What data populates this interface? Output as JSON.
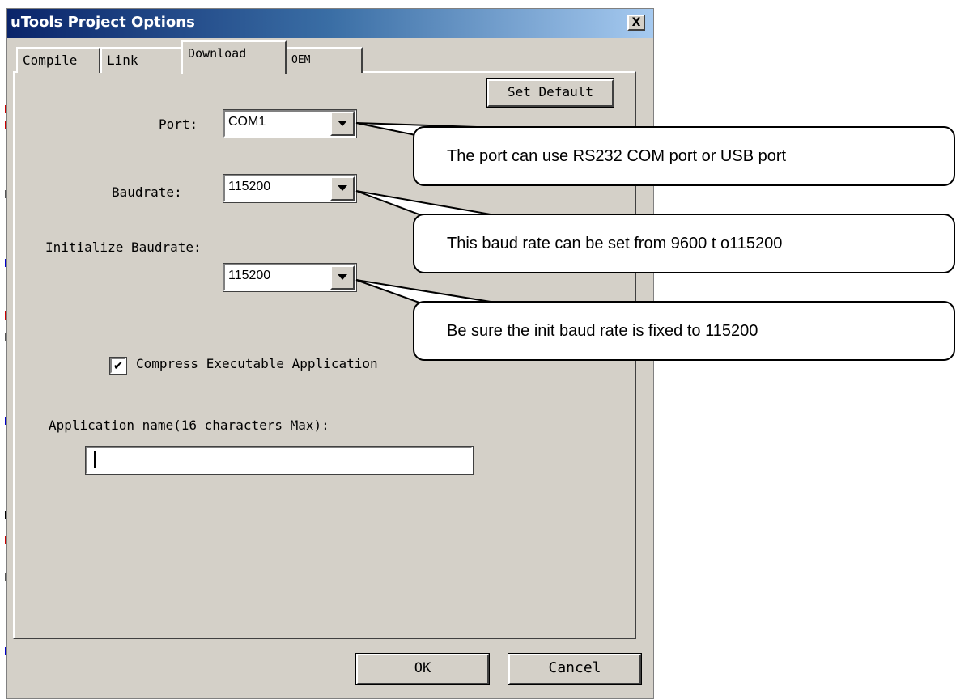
{
  "window": {
    "title": "uTools Project Options",
    "close_label": "X"
  },
  "tabs": [
    {
      "label": "Compile"
    },
    {
      "label": "Link"
    },
    {
      "label": "Download"
    },
    {
      "label": "OEM"
    }
  ],
  "buttons": {
    "set_default": "Set Default",
    "ok": "OK",
    "cancel": "Cancel"
  },
  "fields": {
    "port": {
      "label": "Port:",
      "value": "COM1"
    },
    "baudrate": {
      "label": "Baudrate:",
      "value": "115200"
    },
    "init_baudrate": {
      "label": "Initialize Baudrate:",
      "value": "115200"
    },
    "compress": {
      "label": "Compress Executable Application",
      "checked": true,
      "mark": "✔"
    },
    "app_name": {
      "label": "Application name(16 characters Max):",
      "value": ""
    }
  },
  "callouts": [
    {
      "text": "The port can use RS232 COM port or USB port"
    },
    {
      "text": "This baud rate can be set from 9600 t o115200"
    },
    {
      "text": "Be sure the init baud rate is fixed to 115200"
    }
  ],
  "colors": {
    "title_gradient_start": "#0a246a",
    "title_gradient_end": "#a6caf0",
    "dialog_face": "#d4d0c8"
  }
}
